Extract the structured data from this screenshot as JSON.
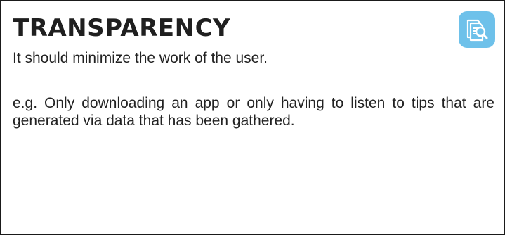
{
  "card": {
    "title": "TRANSPARENCY",
    "icon": "document-search-icon",
    "accent_color": "#6ec1ea",
    "paragraphs": [
      "It should minimize the work of the user.",
      "e.g. Only downloading an app or only having to listen to tips that are generated via data that has been gathered."
    ]
  }
}
